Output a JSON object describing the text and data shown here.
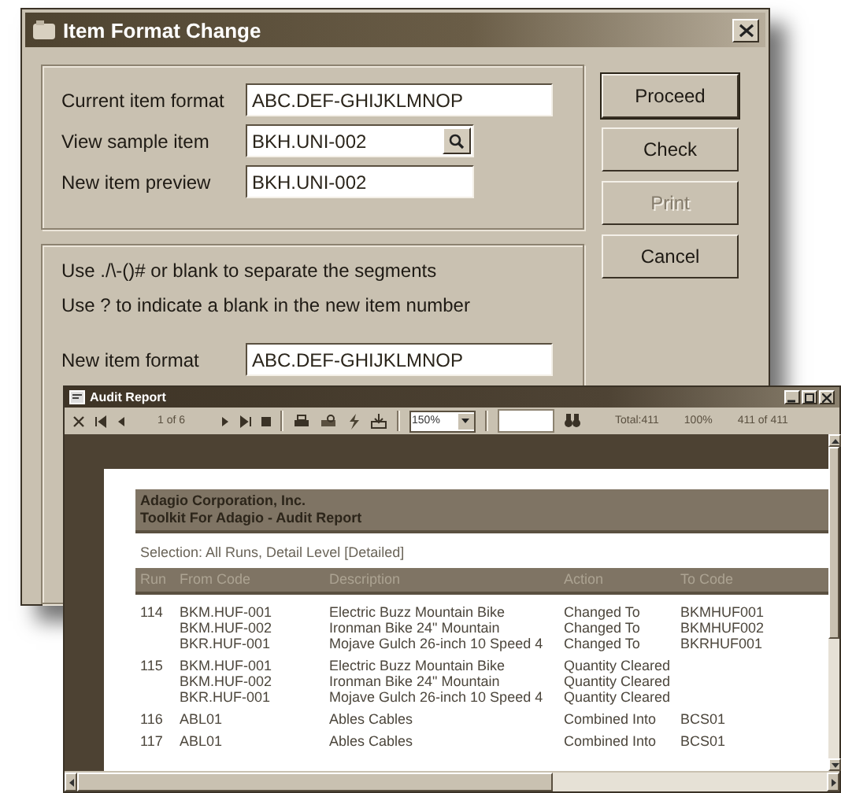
{
  "dialog": {
    "title": "Item Format Change",
    "fields": [
      {
        "label": "Current item format",
        "value": "ABC.DEF-GHIJKLMNOP",
        "kind": "wide"
      },
      {
        "label": "View sample item",
        "value": "BKH.UNI-002",
        "kind": "lookup"
      },
      {
        "label": "New item preview",
        "value": "BKH.UNI-002",
        "kind": "short"
      }
    ],
    "hints": [
      "Use ./\\-()# or blank to separate the segments",
      "Use ? to indicate a blank in the new item number"
    ],
    "new_format": {
      "label": "New item format",
      "value": "ABC.DEF-GHIJKLMNOP"
    },
    "buttons": [
      {
        "label": "Proceed",
        "default": true,
        "disabled": false
      },
      {
        "label": "Check",
        "default": false,
        "disabled": false
      },
      {
        "label": "Print",
        "default": false,
        "disabled": true
      },
      {
        "label": "Cancel",
        "default": false,
        "disabled": false
      }
    ]
  },
  "report": {
    "title": "Audit Report",
    "toolbar": {
      "page": "1 of 6",
      "zoom": "150%",
      "total": "Total:411",
      "percent": "100%",
      "count": "411 of 411"
    },
    "company": "Adagio Corporation, Inc.",
    "report_title": "Toolkit For Adagio - Audit Report",
    "selection": "Selection: All Runs, Detail Level [Detailed]",
    "columns": [
      "Run",
      "From Code",
      "Description",
      "Action",
      "To Code"
    ],
    "rows": [
      {
        "run": "114",
        "lines": [
          {
            "from": "BKM.HUF-001",
            "description": "Electric Buzz Mountain Bike",
            "action": "Changed To",
            "to": "BKMHUF001"
          },
          {
            "from": "BKM.HUF-002",
            "description": "Ironman Bike 24\" Mountain",
            "action": "Changed To",
            "to": "BKMHUF002"
          },
          {
            "from": "BKR.HUF-001",
            "description": "Mojave Gulch 26-inch 10 Speed 4",
            "action": "Changed To",
            "to": "BKRHUF001"
          }
        ]
      },
      {
        "run": "115",
        "lines": [
          {
            "from": "BKM.HUF-001",
            "description": "Electric Buzz Mountain Bike",
            "action": "Quantity Cleared"
          },
          {
            "from": "BKM.HUF-002",
            "description": "Ironman Bike 24\" Mountain",
            "action": "Quantity Cleared"
          },
          {
            "from": "BKR.HUF-001",
            "description": "Mojave Gulch 26-inch 10 Speed 4",
            "action": "Quantity Cleared"
          }
        ]
      },
      {
        "run": "116",
        "lines": [
          {
            "from": "ABL01",
            "description": "Ables Cables",
            "action": "Combined Into",
            "to": "BCS01"
          }
        ]
      },
      {
        "run": "117",
        "lines": [
          {
            "from": "ABL01",
            "description": "Ables Cables",
            "action": "Combined Into",
            "to": "BCS01"
          }
        ]
      }
    ]
  }
}
